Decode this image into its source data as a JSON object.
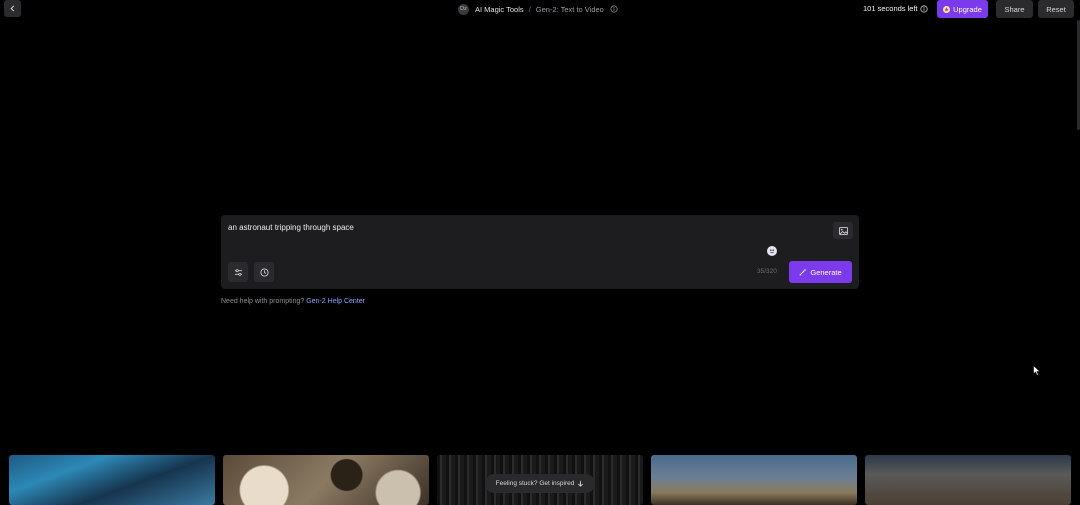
{
  "header": {
    "workspace_initials": "Dz",
    "breadcrumb": [
      "AI Magic Tools",
      "Gen-2: Text to Video"
    ],
    "separator": "/",
    "credits_left": "101 seconds left",
    "upgrade_label": "Upgrade",
    "share_label": "Share",
    "reset_label": "Reset"
  },
  "prompt": {
    "value": "an astronaut tripping through space",
    "char_count": "35/320",
    "generate_label": "Generate"
  },
  "help": {
    "text": "Need help with prompting?",
    "link_label": "Gen-2 Help Center"
  },
  "gallery": {
    "inspire_label": "Feeling stuck? Get inspired"
  },
  "colors": {
    "accent": "#7c3aed",
    "background": "#000000",
    "panel": "#1d1d20",
    "link": "#7fa7ff"
  },
  "icons": [
    "chevron-left-icon",
    "info-icon",
    "image-icon",
    "emoji-icon",
    "sliders-icon",
    "clock-icon",
    "wand-icon",
    "arrow-down-icon"
  ]
}
